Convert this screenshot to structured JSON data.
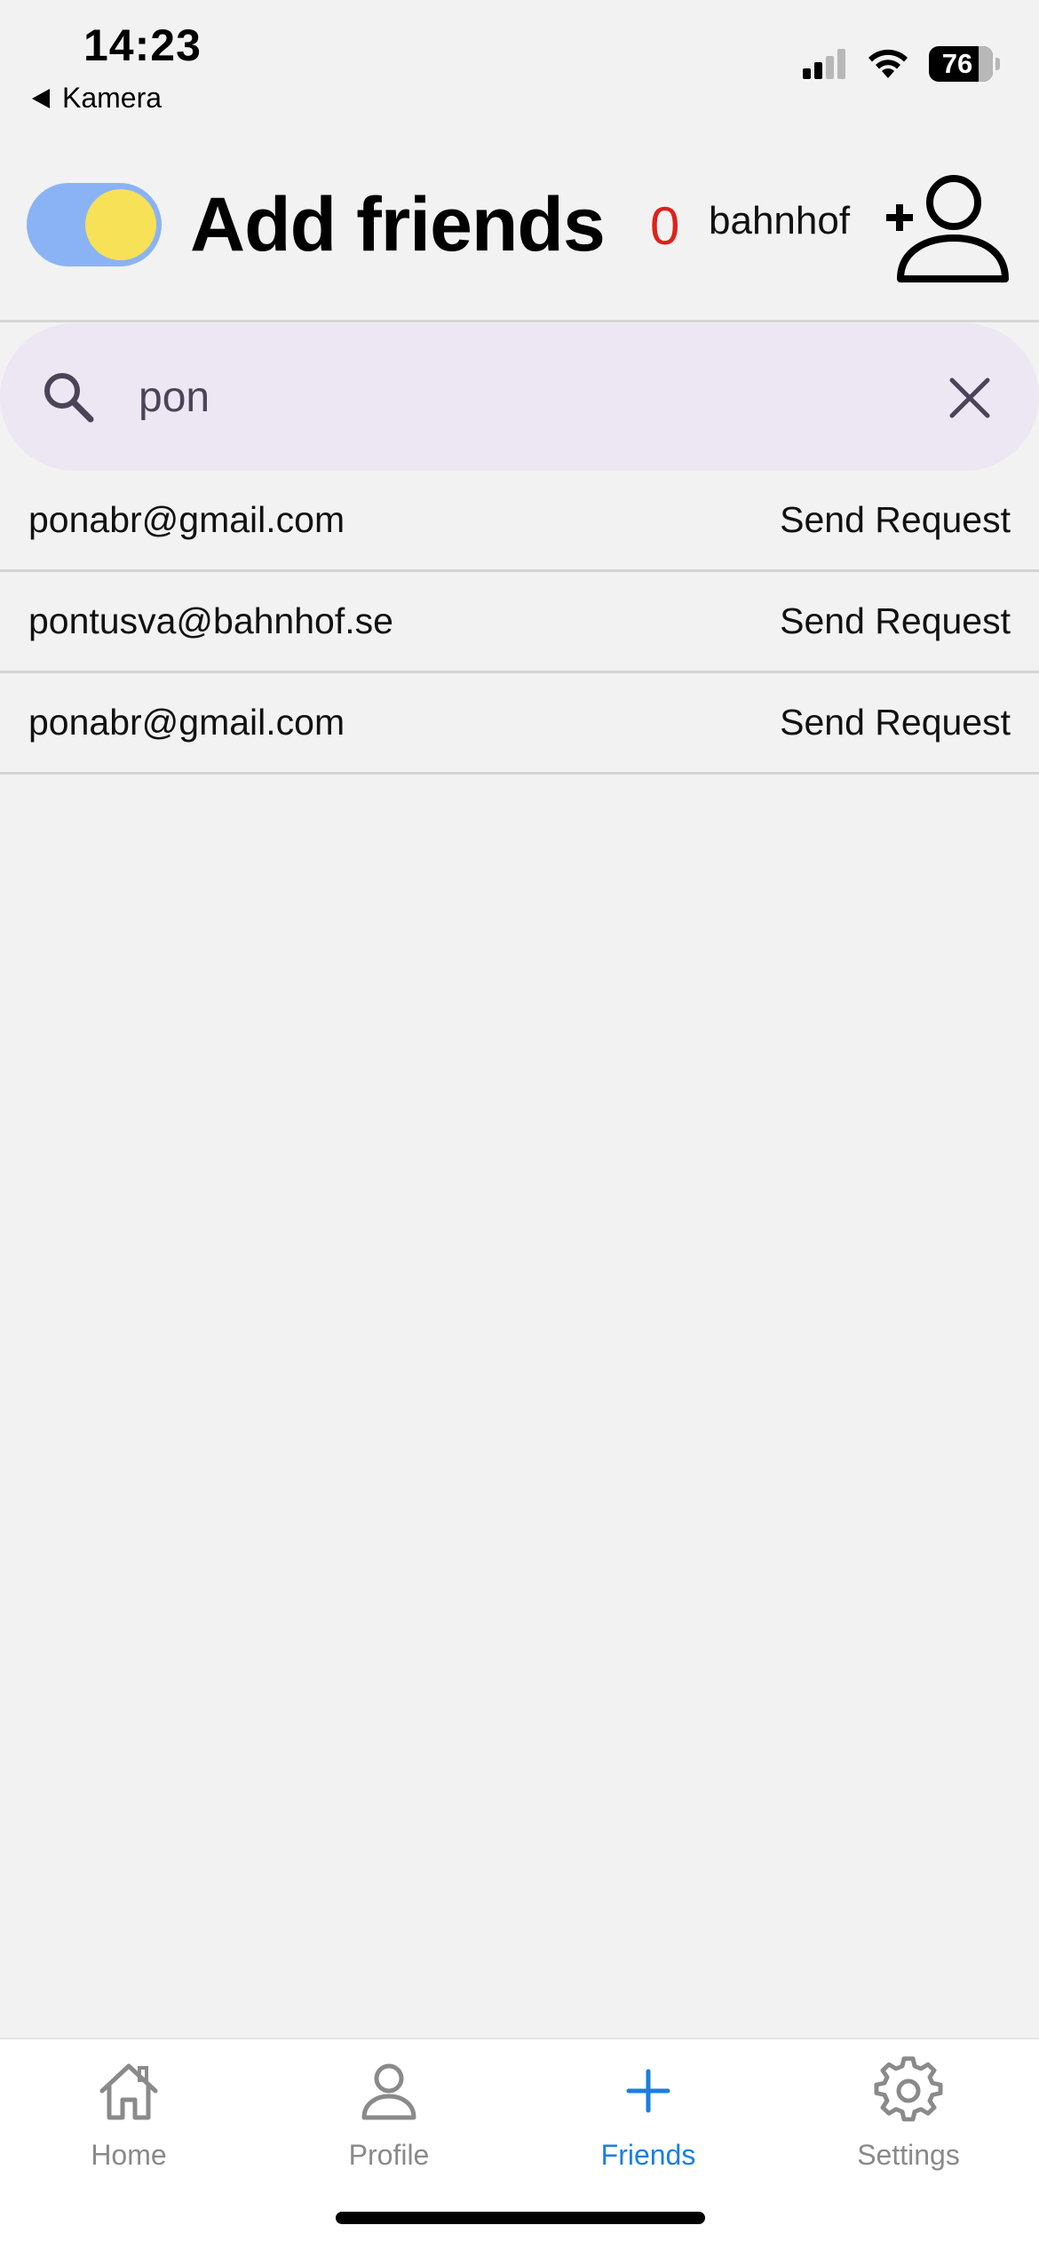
{
  "status_bar": {
    "time": "14:23",
    "back_app": "Kamera",
    "battery": "76",
    "icons": [
      "cellular-signal-icon",
      "wifi-icon",
      "battery-icon"
    ]
  },
  "header": {
    "title": "Add friends",
    "request_count": "0",
    "username": "bahnhof",
    "toggle_on": true,
    "toggle_color": "#8ab3f5",
    "knob_color": "#f7e157",
    "count_color": "#e0201b"
  },
  "search": {
    "value": "pon",
    "placeholder": ""
  },
  "results": [
    {
      "email": "ponabr@gmail.com",
      "action": "Send Request"
    },
    {
      "email": "pontusva@bahnhof.se",
      "action": "Send Request"
    },
    {
      "email": "ponabr@gmail.com",
      "action": "Send Request"
    }
  ],
  "tabs": [
    {
      "label": "Home",
      "icon": "home-icon",
      "active": false
    },
    {
      "label": "Profile",
      "icon": "person-icon",
      "active": false
    },
    {
      "label": "Friends",
      "icon": "plus-icon",
      "active": true
    },
    {
      "label": "Settings",
      "icon": "gear-icon",
      "active": false
    }
  ],
  "colors": {
    "active_tab": "#1a7fe0",
    "inactive_tab": "#8a8a8a",
    "search_bg": "#ece7f3",
    "page_bg": "#f2f2f2"
  }
}
